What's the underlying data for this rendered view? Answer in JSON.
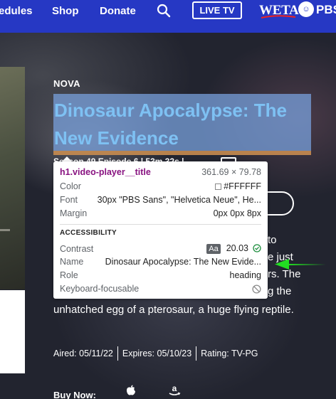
{
  "nav": {
    "items": [
      "edules",
      "Shop",
      "Donate"
    ],
    "live_label": "LIVE TV",
    "station_label": "WETA",
    "pbs_label": "PBS"
  },
  "hero": {
    "eyebrow": "NOVA",
    "title": "Dinosaur Apocalypse: The New Evidence",
    "meta_peek": "Season 49 Episode 6 | 53m 32s |",
    "desc_right_lines": [
      "to",
      "e just",
      "rs. The",
      "g the"
    ],
    "desc_tail": "unhatched egg of a pterosaur, a huge flying reptile.",
    "aired": "Aired: 05/11/22",
    "expires": "Expires: 05/10/23",
    "rating": "Rating: TV-PG",
    "buy_label": "Buy Now:"
  },
  "inspector": {
    "selector": "h1.video-player__title",
    "size": "361.69 × 79.78",
    "rows": [
      {
        "label": "Color",
        "value": "#FFFFFF"
      },
      {
        "label": "Font",
        "value": "30px \"PBS Sans\", \"Helvetica Neue\", He..."
      },
      {
        "label": "Margin",
        "value": "0px 0px 8px"
      }
    ],
    "section_title": "ACCESSIBILITY",
    "a11y_rows": [
      {
        "label": "Contrast",
        "badge": "Aa",
        "value": "20.03"
      },
      {
        "label": "Name",
        "value": "Dinosaur Apocalypse: The New Evide..."
      },
      {
        "label": "Role",
        "value": "heading"
      },
      {
        "label": "Keyboard-focusable",
        "value": ""
      }
    ]
  },
  "colors": {
    "nav_bg": "#2638c4",
    "title_text": "#7ec1f3",
    "selector": "#881280",
    "annotation_arrow": "#22dd22",
    "contrast_ok": "#1e8e3e"
  }
}
